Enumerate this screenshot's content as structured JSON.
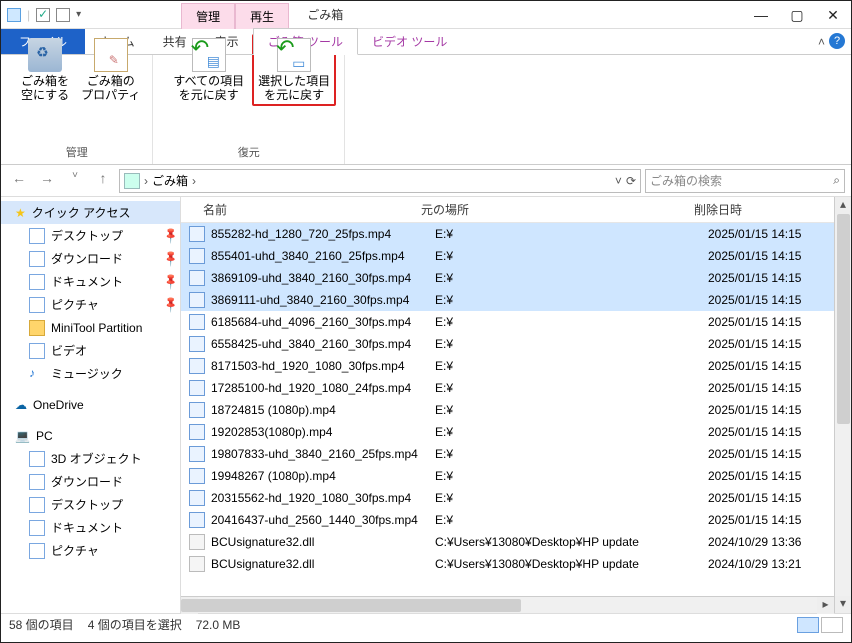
{
  "title": "ごみ箱",
  "context_tabs": {
    "manage": "管理",
    "play": "再生"
  },
  "menutabs": {
    "file": "ファイル",
    "home": "ホーム",
    "share": "共有",
    "view": "表示",
    "rbtools": "ごみ箱 ツール",
    "vidtools": "ビデオ ツール"
  },
  "ribbon": {
    "group_manage": "管理",
    "group_restore": "復元",
    "empty": {
      "l1": "ごみ箱を",
      "l2": "空にする"
    },
    "props": {
      "l1": "ごみ箱の",
      "l2": "プロパティ"
    },
    "restore_all": {
      "l1": "すべての項目",
      "l2": "を元に戻す"
    },
    "restore_sel": {
      "l1": "選択した項目",
      "l2": "を元に戻す"
    }
  },
  "address": {
    "root": "ごみ箱"
  },
  "search_placeholder": "ごみ箱の検索",
  "sidebar": {
    "quick_access": "クイック アクセス",
    "desktop": "デスクトップ",
    "downloads": "ダウンロード",
    "documents": "ドキュメント",
    "pictures": "ピクチャ",
    "minitool": "MiniTool Partition",
    "video": "ビデオ",
    "music": "ミュージック",
    "onedrive": "OneDrive",
    "pc": "PC",
    "threeD": "3D オブジェクト",
    "downloads2": "ダウンロード",
    "desktop2": "デスクトップ",
    "documents2": "ドキュメント",
    "pictures2": "ピクチャ"
  },
  "columns": {
    "name": "名前",
    "location": "元の場所",
    "date": "削除日時"
  },
  "files": [
    {
      "name": "855282-hd_1280_720_25fps.mp4",
      "location": "E:¥",
      "date": "2025/01/15 14:15",
      "selected": true,
      "type": "mp4"
    },
    {
      "name": "855401-uhd_3840_2160_25fps.mp4",
      "location": "E:¥",
      "date": "2025/01/15 14:15",
      "selected": true,
      "type": "mp4"
    },
    {
      "name": "3869109-uhd_3840_2160_30fps.mp4",
      "location": "E:¥",
      "date": "2025/01/15 14:15",
      "selected": true,
      "type": "mp4"
    },
    {
      "name": "3869111-uhd_3840_2160_30fps.mp4",
      "location": "E:¥",
      "date": "2025/01/15 14:15",
      "selected": true,
      "type": "mp4"
    },
    {
      "name": "6185684-uhd_4096_2160_30fps.mp4",
      "location": "E:¥",
      "date": "2025/01/15 14:15",
      "selected": false,
      "type": "mp4"
    },
    {
      "name": "6558425-uhd_3840_2160_30fps.mp4",
      "location": "E:¥",
      "date": "2025/01/15 14:15",
      "selected": false,
      "type": "mp4"
    },
    {
      "name": "8171503-hd_1920_1080_30fps.mp4",
      "location": "E:¥",
      "date": "2025/01/15 14:15",
      "selected": false,
      "type": "mp4"
    },
    {
      "name": "17285100-hd_1920_1080_24fps.mp4",
      "location": "E:¥",
      "date": "2025/01/15 14:15",
      "selected": false,
      "type": "mp4"
    },
    {
      "name": "18724815 (1080p).mp4",
      "location": "E:¥",
      "date": "2025/01/15 14:15",
      "selected": false,
      "type": "mp4"
    },
    {
      "name": "19202853(1080p).mp4",
      "location": "E:¥",
      "date": "2025/01/15 14:15",
      "selected": false,
      "type": "mp4"
    },
    {
      "name": "19807833-uhd_3840_2160_25fps.mp4",
      "location": "E:¥",
      "date": "2025/01/15 14:15",
      "selected": false,
      "type": "mp4"
    },
    {
      "name": "19948267 (1080p).mp4",
      "location": "E:¥",
      "date": "2025/01/15 14:15",
      "selected": false,
      "type": "mp4"
    },
    {
      "name": "20315562-hd_1920_1080_30fps.mp4",
      "location": "E:¥",
      "date": "2025/01/15 14:15",
      "selected": false,
      "type": "mp4"
    },
    {
      "name": "20416437-uhd_2560_1440_30fps.mp4",
      "location": "E:¥",
      "date": "2025/01/15 14:15",
      "selected": false,
      "type": "mp4"
    },
    {
      "name": "BCUsignature32.dll",
      "location": "C:¥Users¥13080¥Desktop¥HP update",
      "date": "2024/10/29 13:36",
      "selected": false,
      "type": "dll"
    },
    {
      "name": "BCUsignature32.dll",
      "location": "C:¥Users¥13080¥Desktop¥HP update",
      "date": "2024/10/29 13:21",
      "selected": false,
      "type": "dll"
    }
  ],
  "status": {
    "count": "58 個の項目",
    "selected": "4 個の項目を選択",
    "size": "72.0 MB"
  }
}
